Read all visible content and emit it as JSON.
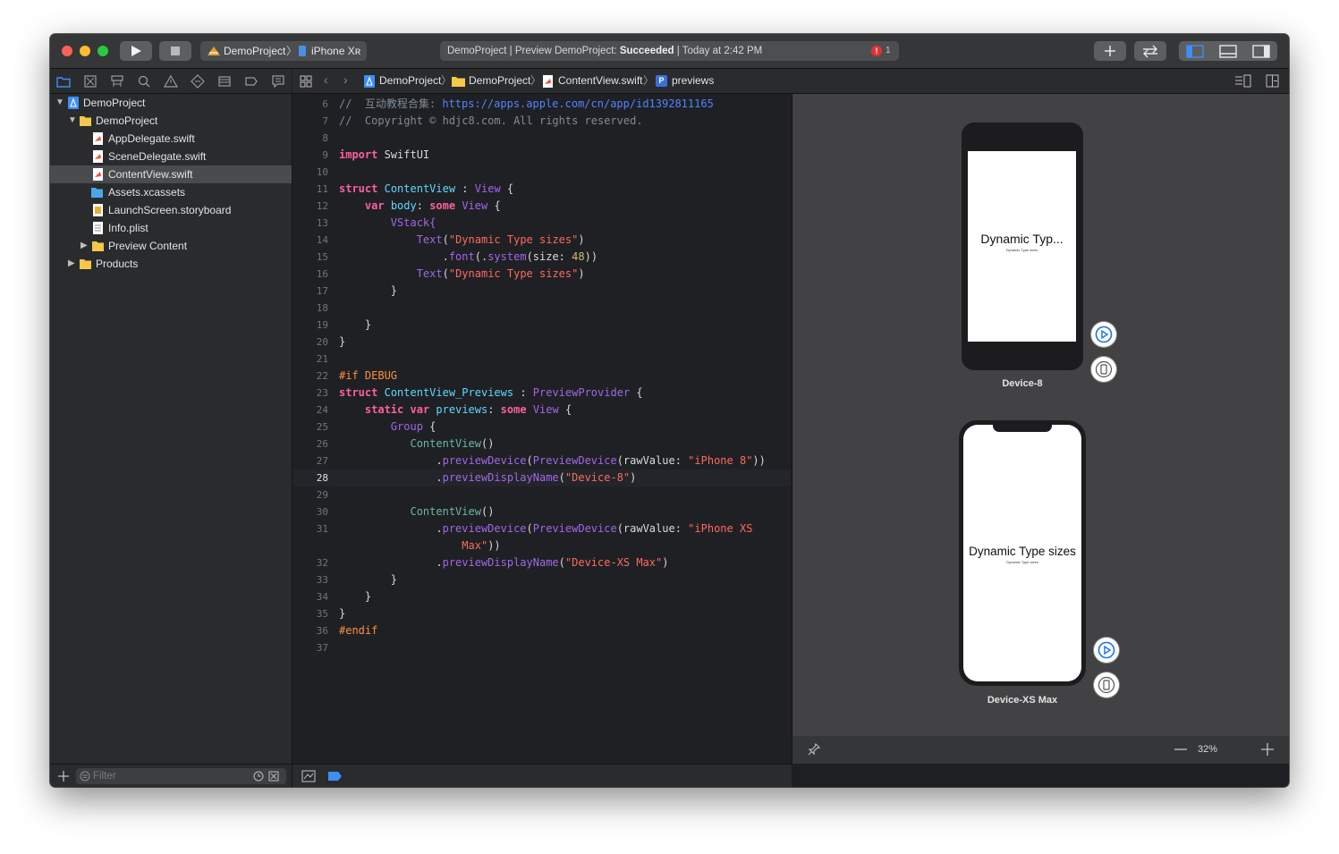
{
  "toolbar": {
    "scheme_project": "DemoProject",
    "scheme_device": "iPhone Xʀ",
    "activity_prefix": "DemoProject | Preview DemoProject: ",
    "activity_status": "Succeeded",
    "activity_time": " | Today at 2:42 PM",
    "issue_count": "1"
  },
  "jumpbar": {
    "crumbs": [
      "DemoProject",
      "DemoProject",
      "ContentView.swift",
      "previews"
    ],
    "symbol_badge": "P"
  },
  "navigator": {
    "items": [
      {
        "label": "DemoProject"
      },
      {
        "label": "DemoProject"
      },
      {
        "label": "AppDelegate.swift"
      },
      {
        "label": "SceneDelegate.swift"
      },
      {
        "label": "ContentView.swift"
      },
      {
        "label": "Assets.xcassets"
      },
      {
        "label": "LaunchScreen.storyboard"
      },
      {
        "label": "Info.plist"
      },
      {
        "label": "Preview Content"
      },
      {
        "label": "Products"
      }
    ],
    "filter_placeholder": "Filter"
  },
  "editor": {
    "line_numbers": [
      "6",
      "7",
      "8",
      "9",
      "10",
      "11",
      "12",
      "13",
      "14",
      "15",
      "16",
      "17",
      "18",
      "19",
      "20",
      "21",
      "22",
      "23",
      "24",
      "25",
      "26",
      "27",
      "28",
      "29",
      "30",
      "31",
      "",
      "32",
      "33",
      "34",
      "35",
      "36",
      "37"
    ],
    "current_line": "28",
    "t": {
      "l6a": "//  互动教程合集: ",
      "l6b": "https://apps.apple.com/cn/app/id1392811165",
      "l7": "//  Copyright © hdjc8.com. All rights reserved.",
      "import": "import",
      "swiftui": " SwiftUI",
      "struct": "struct",
      "contentview": "ContentView",
      "colon": " : ",
      "view": "View",
      "brace_open": " {",
      "var": "var",
      "body": "body",
      "colon2": ": ",
      "some": "some",
      "vstack": "VStack{",
      "text": "Text",
      "str_dyn": "\"Dynamic Type sizes\"",
      "paren_open": "(",
      "paren_close": ")",
      "dot": ".",
      "font": "font",
      "system": "system",
      "size_lbl": "(size: ",
      "n48": "48",
      "close2": "))",
      "brace_close": "}",
      "ifdebug": "#if DEBUG",
      "contentview_previews": "ContentView_Previews",
      "previewprovider": "PreviewProvider",
      "static": "static",
      "previews": "previews",
      "group": "Group",
      "contentview_call": "ContentView",
      "call_parens": "()",
      "previewdevice": "previewDevice",
      "previewdevice_type": "PreviewDevice",
      "rawvalue": "(rawValue: ",
      "str_iphone8": "\"iPhone 8\"",
      "previewdisplayname": "previewDisplayName",
      "str_device8": "\"Device-8\"",
      "str_iphonexs_a": "\"iPhone XS",
      "str_iphonexs_b": "Max\"",
      "str_devicexsmax": "\"Device-XS Max\"",
      "endif": "#endif"
    }
  },
  "canvas": {
    "device1_label": "Device-8",
    "device2_label": "Device-XS Max",
    "preview1_large": "Dynamic Typ...",
    "preview_small": "Dynamic Type sizes",
    "preview2_large": "Dynamic Type sizes",
    "zoom": "32%"
  }
}
